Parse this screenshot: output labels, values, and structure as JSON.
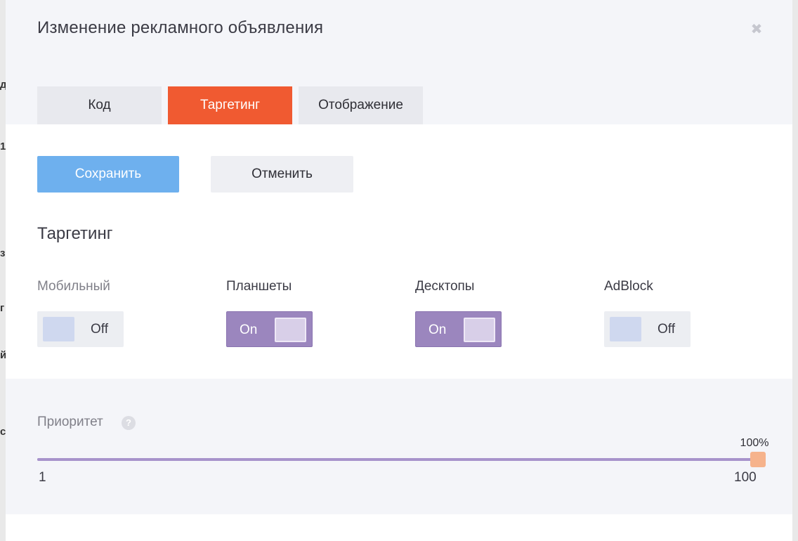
{
  "modal": {
    "title": "Изменение рекламного объявления",
    "close_icon": "close-icon",
    "colors": {
      "accent": "#f05a31",
      "primary": "#6eb0ee",
      "toggle_on": "#9b86be",
      "slider": "#a793cb",
      "slider_thumb": "#f6b38c"
    }
  },
  "tabs": [
    {
      "label": "Код",
      "active": false
    },
    {
      "label": "Таргетинг",
      "active": true
    },
    {
      "label": "Отображение",
      "active": false
    }
  ],
  "actions": {
    "save_label": "Сохранить",
    "cancel_label": "Отменить"
  },
  "targeting": {
    "title": "Таргетинг",
    "toggles": [
      {
        "label": "Мобильный",
        "state": "Off"
      },
      {
        "label": "Планшеты",
        "state": "On"
      },
      {
        "label": "Десктопы",
        "state": "On"
      },
      {
        "label": "AdBlock",
        "state": "Off"
      }
    ]
  },
  "priority": {
    "label": "Приоритет",
    "help_icon": "question-icon",
    "help_glyph": "?",
    "min": "1",
    "max": "100",
    "value_label": "100%",
    "value_percent": 100
  }
}
